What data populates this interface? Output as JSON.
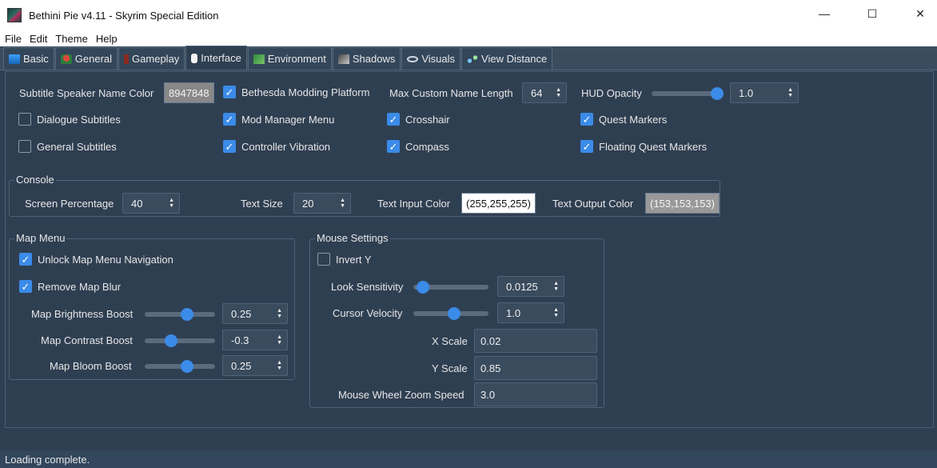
{
  "window": {
    "title": "Bethini Pie v4.11 - Skyrim Special Edition"
  },
  "menu": [
    "File",
    "Edit",
    "Theme",
    "Help"
  ],
  "tabs": [
    {
      "label": "Basic",
      "icon": "basic-icon",
      "active": false
    },
    {
      "label": "General",
      "icon": "general-icon",
      "active": false
    },
    {
      "label": "Gameplay",
      "icon": "gameplay-icon",
      "active": false
    },
    {
      "label": "Interface",
      "icon": "interface-icon",
      "active": true
    },
    {
      "label": "Environment",
      "icon": "environment-icon",
      "active": false
    },
    {
      "label": "Shadows",
      "icon": "shadows-icon",
      "active": false
    },
    {
      "label": "Visuals",
      "icon": "visuals-icon",
      "active": false
    },
    {
      "label": "View Distance",
      "icon": "view-distance-icon",
      "active": false
    }
  ],
  "top": {
    "subtitle_color_label": "Subtitle Speaker Name Color",
    "subtitle_color_value": "8947848",
    "dialogue_subtitles": {
      "label": "Dialogue Subtitles",
      "checked": false
    },
    "general_subtitles": {
      "label": "General Subtitles",
      "checked": false
    },
    "bethesda_modding": {
      "label": "Bethesda Modding Platform",
      "checked": true
    },
    "mod_manager_menu": {
      "label": "Mod Manager Menu",
      "checked": true
    },
    "controller_vibration": {
      "label": "Controller Vibration",
      "checked": true
    },
    "max_name_length_label": "Max Custom Name Length",
    "max_name_length_value": "64",
    "crosshair": {
      "label": "Crosshair",
      "checked": true
    },
    "compass": {
      "label": "Compass",
      "checked": true
    },
    "hud_opacity_label": "HUD Opacity",
    "hud_opacity_value": "1.0",
    "hud_opacity_level": 1.0,
    "quest_markers": {
      "label": "Quest Markers",
      "checked": true
    },
    "floating_quest_markers": {
      "label": "Floating Quest Markers",
      "checked": true
    }
  },
  "console": {
    "title": "Console",
    "screen_percentage_label": "Screen Percentage",
    "screen_percentage_value": "40",
    "text_size_label": "Text Size",
    "text_size_value": "20",
    "text_input_color_label": "Text Input Color",
    "text_input_color_value": "(255,255,255)",
    "text_output_color_label": "Text Output Color",
    "text_output_color_value": "(153,153,153)"
  },
  "map_menu": {
    "title": "Map Menu",
    "unlock_nav": {
      "label": "Unlock Map Menu Navigation",
      "checked": true
    },
    "remove_blur": {
      "label": "Remove Map Blur",
      "checked": true
    },
    "brightness_label": "Map Brightness Boost",
    "brightness_value": "0.25",
    "brightness_level": 0.63,
    "contrast_label": "Map Contrast Boost",
    "contrast_value": "-0.3",
    "contrast_level": 0.35,
    "bloom_label": "Map Bloom Boost",
    "bloom_value": "0.25",
    "bloom_level": 0.63
  },
  "mouse": {
    "title": "Mouse Settings",
    "invert_y": {
      "label": "Invert Y",
      "checked": false
    },
    "look_sensitivity_label": "Look Sensitivity",
    "look_sensitivity_value": "0.0125",
    "look_sensitivity_level": 0.05,
    "cursor_velocity_label": "Cursor Velocity",
    "cursor_velocity_value": "1.0",
    "cursor_velocity_level": 0.55,
    "x_scale_label": "X Scale",
    "x_scale_value": "0.02",
    "y_scale_label": "Y Scale",
    "y_scale_value": "0.85",
    "wheel_zoom_label": "Mouse Wheel Zoom Speed",
    "wheel_zoom_value": "3.0"
  },
  "status": "Loading complete.",
  "colors": {
    "accent": "#3b8be8",
    "background": "#2f3f52",
    "input_color_swatch": "#ffffff",
    "output_color_swatch": "#999999",
    "subtitle_swatch": "#888888"
  }
}
